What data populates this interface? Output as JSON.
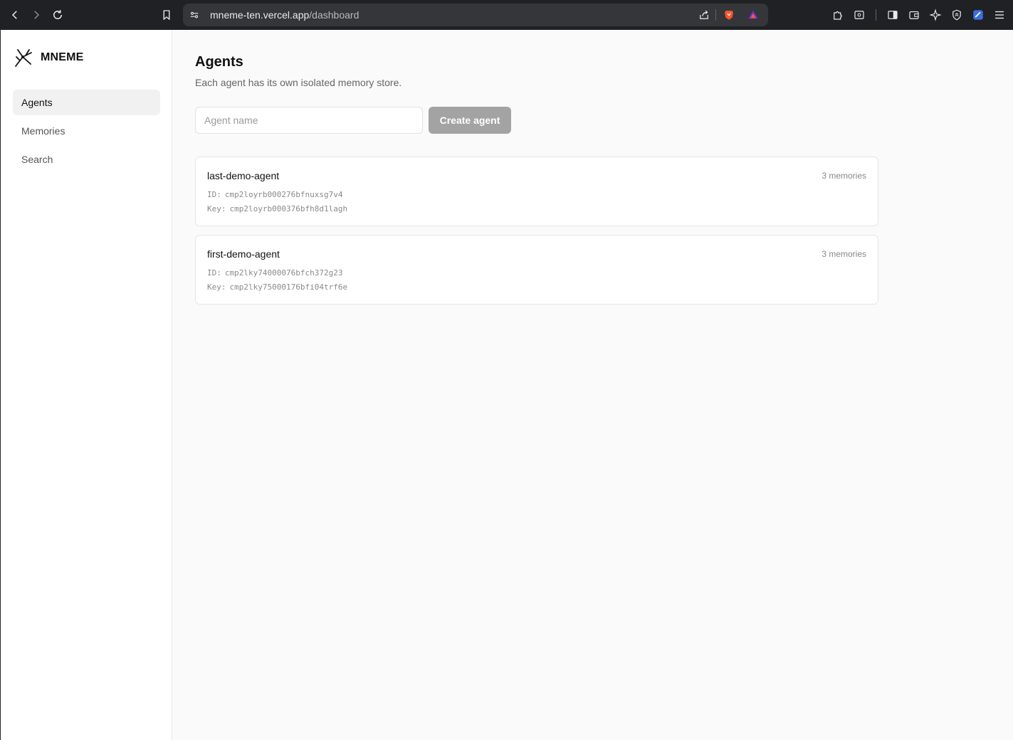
{
  "browser": {
    "url_host": "mneme-ten.vercel.app",
    "url_path": "/dashboard"
  },
  "sidebar": {
    "brand": "MNEME",
    "items": [
      {
        "label": "Agents",
        "active": true
      },
      {
        "label": "Memories",
        "active": false
      },
      {
        "label": "Search",
        "active": false
      }
    ]
  },
  "main": {
    "title": "Agents",
    "subtitle": "Each agent has its own isolated memory store.",
    "input_placeholder": "Agent name",
    "create_label": "Create agent",
    "agents": [
      {
        "name": "last-demo-agent",
        "count": "3 memories",
        "id_label": "ID:",
        "id": "cmp2loyrb000276bfnuxsg7v4",
        "key_label": "Key:",
        "key": "cmp2loyrb000376bfh8d1lagh"
      },
      {
        "name": "first-demo-agent",
        "count": "3 memories",
        "id_label": "ID:",
        "id": "cmp2lky74000076bfch372g23",
        "key_label": "Key:",
        "key": "cmp2lky75000176bfi04trf6e"
      }
    ]
  },
  "colors": {
    "chrome": "#202124",
    "urlbar": "#35363a",
    "button_disabled": "#a3a3a3",
    "active_nav": "#f1f1f1"
  }
}
